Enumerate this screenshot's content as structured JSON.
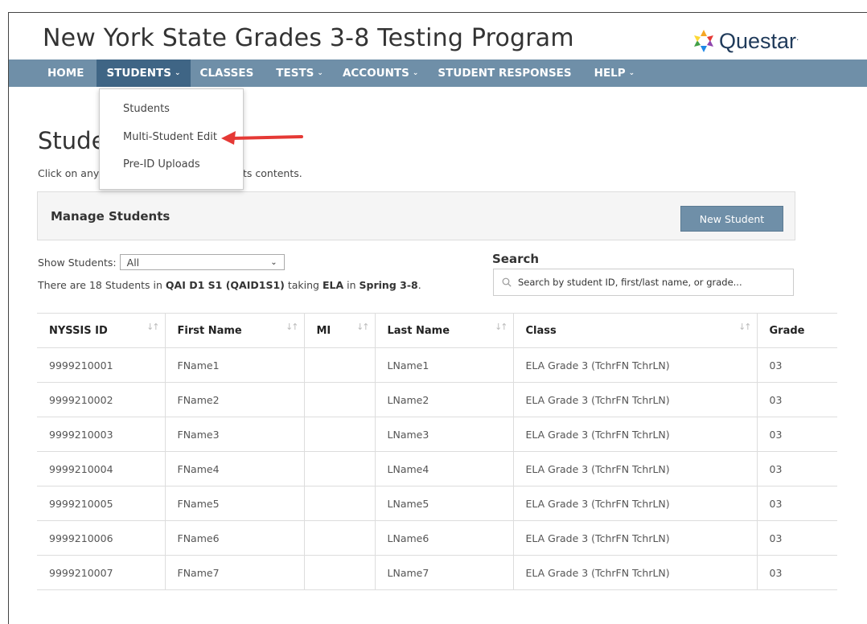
{
  "app": {
    "title": "New York State Grades 3-8 Testing Program",
    "logo_text": "Questar",
    "logo_mark": "."
  },
  "nav": {
    "items": [
      {
        "label": "HOME",
        "caret": ""
      },
      {
        "label": "STUDENTS",
        "caret": "⌄"
      },
      {
        "label": "CLASSES",
        "caret": ""
      },
      {
        "label": "TESTS",
        "caret": "⌄"
      },
      {
        "label": "ACCOUNTS",
        "caret": "⌄"
      },
      {
        "label": "STUDENT RESPONSES",
        "caret": ""
      },
      {
        "label": "HELP",
        "caret": "⌄"
      }
    ]
  },
  "dropdown": {
    "items": [
      "Students",
      "Multi-Student Edit",
      "Pre-ID Uploads"
    ]
  },
  "page": {
    "heading": "Stude",
    "hint_1": "Click on any",
    "hint_2": "ts contents."
  },
  "panel": {
    "title": "Manage Students",
    "new_button": "New Student"
  },
  "filter": {
    "label": "Show Students:",
    "selected": "All"
  },
  "info": {
    "prefix": "There are 18 Students in",
    "class": "QAI D1 S1 (QAID1S1)",
    "mid": "taking",
    "subject": "ELA",
    "in": "in",
    "season": "Spring 3-8",
    "suffix": "."
  },
  "search": {
    "label": "Search",
    "placeholder": "Search by student ID, first/last name, or grade..."
  },
  "table": {
    "columns": [
      "NYSSIS ID",
      "First Name",
      "MI",
      "Last Name",
      "Class",
      "Grade"
    ],
    "rows": [
      [
        "9999210001",
        "FName1",
        "",
        "LName1",
        "ELA Grade 3 (TchrFN TchrLN)",
        "03"
      ],
      [
        "9999210002",
        "FName2",
        "",
        "LName2",
        "ELA Grade 3 (TchrFN TchrLN)",
        "03"
      ],
      [
        "9999210003",
        "FName3",
        "",
        "LName3",
        "ELA Grade 3 (TchrFN TchrLN)",
        "03"
      ],
      [
        "9999210004",
        "FName4",
        "",
        "LName4",
        "ELA Grade 3 (TchrFN TchrLN)",
        "03"
      ],
      [
        "9999210005",
        "FName5",
        "",
        "LName5",
        "ELA Grade 3 (TchrFN TchrLN)",
        "03"
      ],
      [
        "9999210006",
        "FName6",
        "",
        "LName6",
        "ELA Grade 3 (TchrFN TchrLN)",
        "03"
      ],
      [
        "9999210007",
        "FName7",
        "",
        "LName7",
        "ELA Grade 3 (TchrFN TchrLN)",
        "03"
      ]
    ]
  },
  "colors": {
    "nav_bg": "#6f8fa8",
    "nav_active": "#3f6585",
    "arrow": "#e53935",
    "button": "#6f8fa8"
  }
}
